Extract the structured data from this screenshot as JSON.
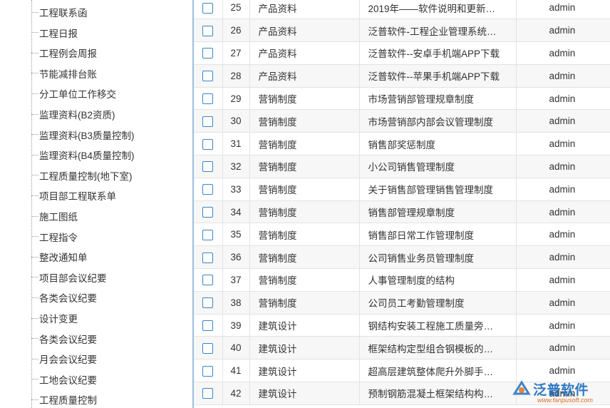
{
  "sidebar": {
    "items": [
      "工程联系函",
      "工程日报",
      "工程例会周报",
      "节能减排台账",
      "分工单位工作移交",
      "监理资料(B2资质)",
      "监理资料(B3质量控制)",
      "监理资料(B4质量控制)",
      "工程质量控制(地下室)",
      "项目部工程联系单",
      "施工图纸",
      "工程指令",
      "整改通知单",
      "项目部会议纪要",
      "各类会议纪要",
      "设计变更",
      "各类会议纪要",
      "月会会议纪要",
      "工地会议纪要",
      "工程质量控制"
    ]
  },
  "table": {
    "rows": [
      {
        "num": "25",
        "category": "产品资料",
        "title": "2019年——软件说明和更新…",
        "user": "admin"
      },
      {
        "num": "26",
        "category": "产品资料",
        "title": "泛普软件-工程企业管理系统…",
        "user": "admin"
      },
      {
        "num": "27",
        "category": "产品资料",
        "title": "泛普软件--安卓手机端APP下载",
        "user": "admin"
      },
      {
        "num": "28",
        "category": "产品资料",
        "title": "泛普软件--苹果手机端APP下载",
        "user": "admin"
      },
      {
        "num": "29",
        "category": "营销制度",
        "title": "市场营销部管理规章制度",
        "user": "admin"
      },
      {
        "num": "30",
        "category": "营销制度",
        "title": "市场营销部内部会议管理制度",
        "user": "admin"
      },
      {
        "num": "31",
        "category": "营销制度",
        "title": "销售部奖惩制度",
        "user": "admin"
      },
      {
        "num": "32",
        "category": "营销制度",
        "title": "小公司销售管理制度",
        "user": "admin"
      },
      {
        "num": "33",
        "category": "营销制度",
        "title": "关于销售部管理销售管理制度",
        "user": "admin"
      },
      {
        "num": "34",
        "category": "营销制度",
        "title": "销售部管理规章制度",
        "user": "admin"
      },
      {
        "num": "35",
        "category": "营销制度",
        "title": "销售部日常工作管理制度",
        "user": "admin"
      },
      {
        "num": "36",
        "category": "营销制度",
        "title": "公司销售业务员管理制度",
        "user": "admin"
      },
      {
        "num": "37",
        "category": "营销制度",
        "title": "人事管理制度的结构",
        "user": "admin"
      },
      {
        "num": "38",
        "category": "营销制度",
        "title": "公司员工考勤管理制度",
        "user": "admin"
      },
      {
        "num": "39",
        "category": "建筑设计",
        "title": "钢结构安装工程施工质量旁…",
        "user": "admin"
      },
      {
        "num": "40",
        "category": "建筑设计",
        "title": "框架结构定型组合钢模板的…",
        "user": "admin"
      },
      {
        "num": "41",
        "category": "建筑设计",
        "title": "超高层建筑整体爬升外脚手…",
        "user": "admin"
      },
      {
        "num": "42",
        "category": "建筑设计",
        "title": "预制钢筋混凝土框架结构构…",
        "user": "admin"
      }
    ]
  },
  "watermark": {
    "name": "泛普软件",
    "url": "www.fanpusoft.com",
    "icon": "fanpu-logo-icon"
  },
  "colors": {
    "checkbox_border": "#3a86c8",
    "divider": "#9bbfe0",
    "row_alt": "#f7f7f7",
    "brand": "#1f6fc0"
  }
}
